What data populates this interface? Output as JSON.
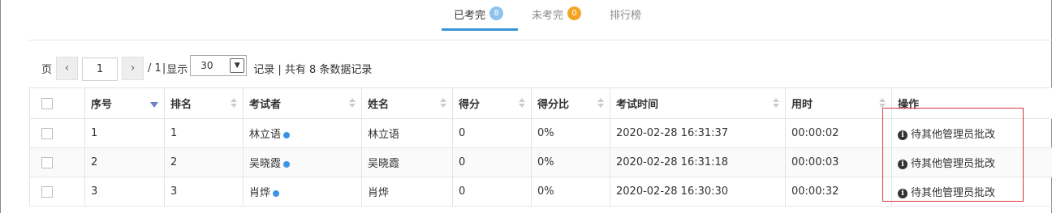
{
  "tabs": [
    {
      "label": "已考完",
      "badge": "8",
      "badge_color": "#8ec2ee",
      "active": true
    },
    {
      "label": "未考完",
      "badge": "0",
      "badge_color": "#f4a425",
      "active": false
    },
    {
      "label": "排行榜",
      "badge": "",
      "active": false
    }
  ],
  "pager": {
    "page_label": "页",
    "prev_icon": "chevron-left-icon",
    "current_page": "1",
    "next_icon": "chevron-right-icon",
    "total_pages": "/ 1",
    "separator": "|",
    "show_label": "显示",
    "page_size": "30",
    "records_text": "记录 | 共有 8 条数据记录"
  },
  "table": {
    "headers": [
      "序号",
      "排名",
      "考试者",
      "姓名",
      "得分",
      "得分比",
      "考试时间",
      "用时",
      "操作"
    ],
    "rows": [
      {
        "index": "1",
        "rank": "1",
        "examinee": "林立语",
        "name": "林立语",
        "score": "0",
        "ratio": "0%",
        "time": "2020-02-28 16:31:37",
        "duration": "00:00:02",
        "action": "待其他管理员批改"
      },
      {
        "index": "2",
        "rank": "2",
        "examinee": "吴晓霞",
        "name": "吴晓霞",
        "score": "0",
        "ratio": "0%",
        "time": "2020-02-28 16:31:18",
        "duration": "00:00:03",
        "action": "待其他管理员批改"
      },
      {
        "index": "3",
        "rank": "3",
        "examinee": "肖烨",
        "name": "肖烨",
        "score": "0",
        "ratio": "0%",
        "time": "2020-02-28 16:30:30",
        "duration": "00:00:32",
        "action": "待其他管理员批改"
      }
    ]
  },
  "colors": {
    "accent": "#3c93d4",
    "online_dot": "#3c93e6",
    "highlight": "#d9363e"
  }
}
